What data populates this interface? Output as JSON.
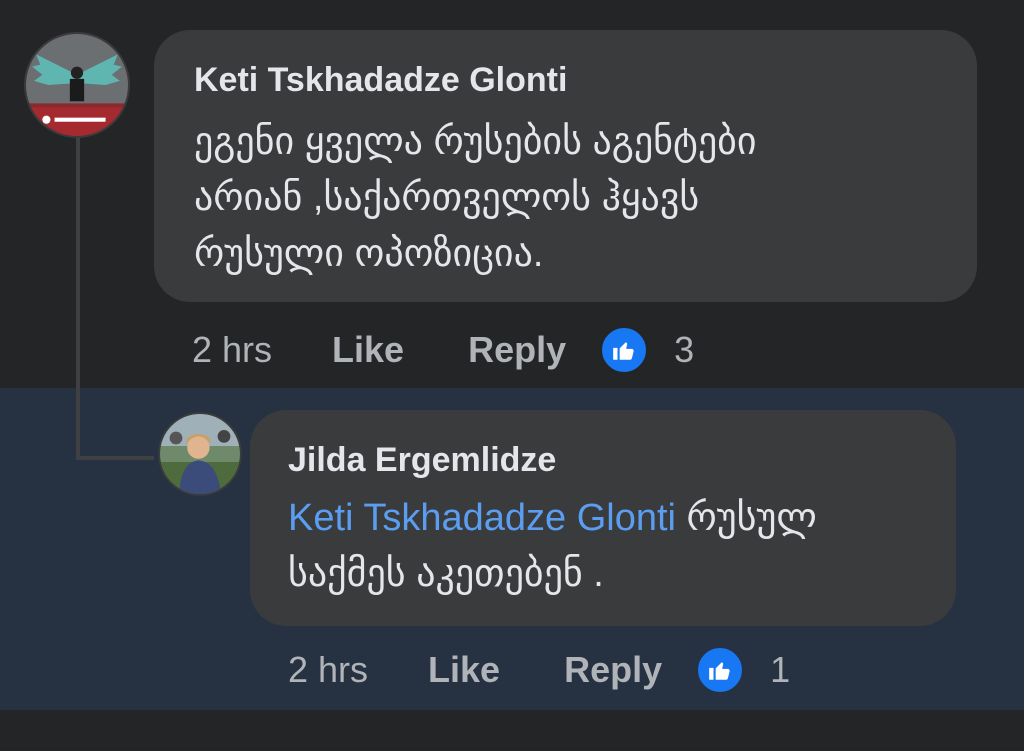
{
  "comments": [
    {
      "author": "Keti Tskhadadze Glonti",
      "text": "ეგენი ყველა რუსების აგენტები\nარიან ,საქართველოს ჰყავს\nრუსული ოპოზიცია.",
      "time": "2 hrs",
      "like_label": "Like",
      "reply_label": "Reply",
      "reaction_count": "3",
      "avatar_icon": "profile-photo-winged-figure"
    }
  ],
  "reply": {
    "author": "Jilda Ergemlidze",
    "mention": "Keti Tskhadadze Glonti",
    "text_line1": " რუსულ",
    "text_line2": "საქმეს აკეთებენ  .",
    "time": "2 hrs",
    "like_label": "Like",
    "reply_label": "Reply",
    "reaction_count": "1",
    "avatar_icon": "profile-photo-woman-outdoors"
  },
  "colors": {
    "background": "#242526",
    "reply_background": "#263142",
    "bubble": "#3a3b3c",
    "text": "#e4e6eb",
    "secondary_text": "#b0b3b8",
    "mention": "#5b9df0",
    "like_badge": "#1877f2"
  }
}
